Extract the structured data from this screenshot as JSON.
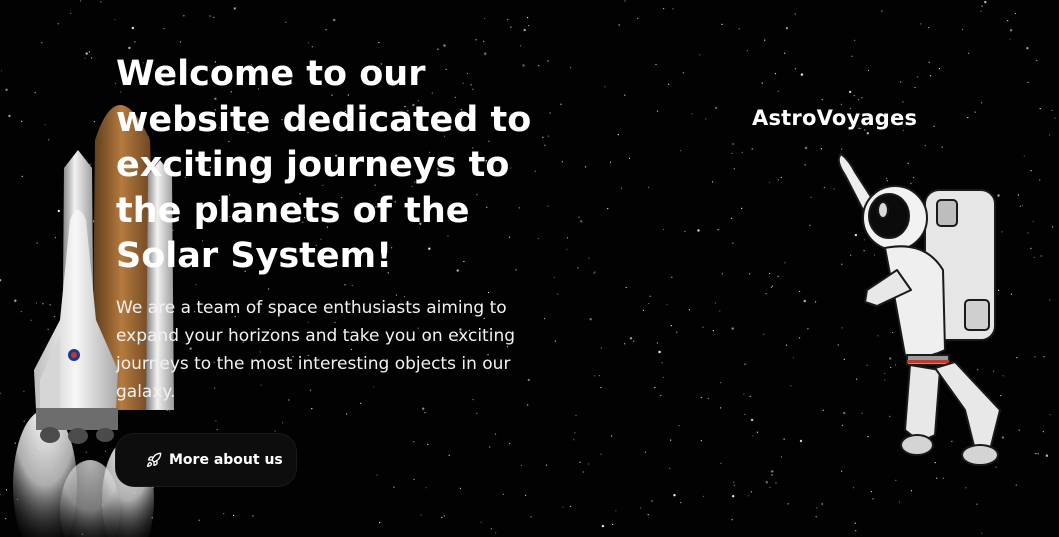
{
  "brand": {
    "name": "AstroVoyages"
  },
  "hero": {
    "headline": "Welcome to our website dedicated to exciting journeys to the planets of the Solar System!",
    "intro": "We are a team of space enthusiasts aiming to expand your horizons and take you on exciting journeys to the most interesting objects in our galaxy.",
    "cta_label": "More about us",
    "cta_icon": "rocket-icon"
  },
  "images": {
    "left": "space-shuttle-illustration",
    "right": "astronaut-illustration"
  },
  "colors": {
    "background": "#020202",
    "text": "#ffffff",
    "button": "#0d0d0d"
  }
}
